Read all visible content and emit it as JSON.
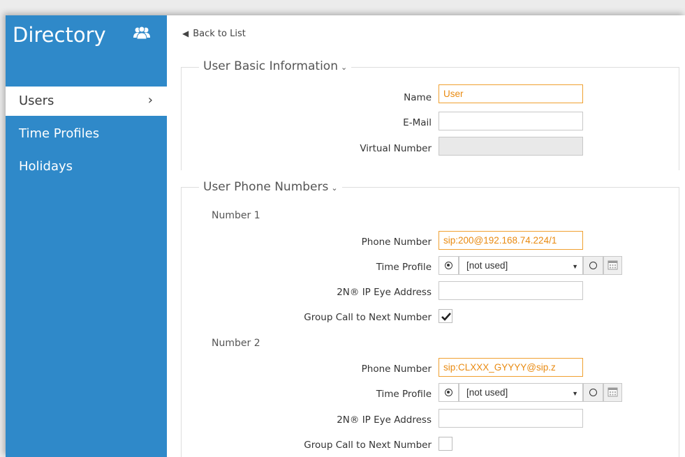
{
  "sidebar": {
    "title": "Directory",
    "title_icon": "users-group-icon",
    "items": [
      {
        "label": "Users",
        "active": true
      },
      {
        "label": "Time Profiles",
        "active": false
      },
      {
        "label": "Holidays",
        "active": false
      }
    ],
    "chevron": "›"
  },
  "back_link": {
    "label": "Back to List",
    "icon": "back-arrow-icon"
  },
  "basic_info": {
    "title": "User Basic Information",
    "name_label": "Name",
    "name_value": "User",
    "email_label": "E-Mail",
    "email_value": "",
    "virtual_label": "Virtual Number",
    "virtual_value": ""
  },
  "phone_numbers": {
    "title": "User Phone Numbers",
    "numbers": [
      {
        "title": "Number 1",
        "phone_label": "Phone Number",
        "phone_value": "sip:200@192.168.74.224/1",
        "time_profile_label": "Time Profile",
        "time_profile_value": "[not used]",
        "eye_label": "2N® IP Eye Address",
        "eye_value": "",
        "group_call_label": "Group Call to Next Number",
        "group_call_checked": true
      },
      {
        "title": "Number 2",
        "phone_label": "Phone Number",
        "phone_value": "sip:CLXXX_GYYYY@sip.z",
        "time_profile_label": "Time Profile",
        "time_profile_value": "[not used]",
        "eye_label": "2N® IP Eye Address",
        "eye_value": "",
        "group_call_label": "Group Call to Next Number",
        "group_call_checked": false
      }
    ]
  },
  "colors": {
    "sidebar": "#2f89c9",
    "accent_orange": "#f0a030"
  }
}
